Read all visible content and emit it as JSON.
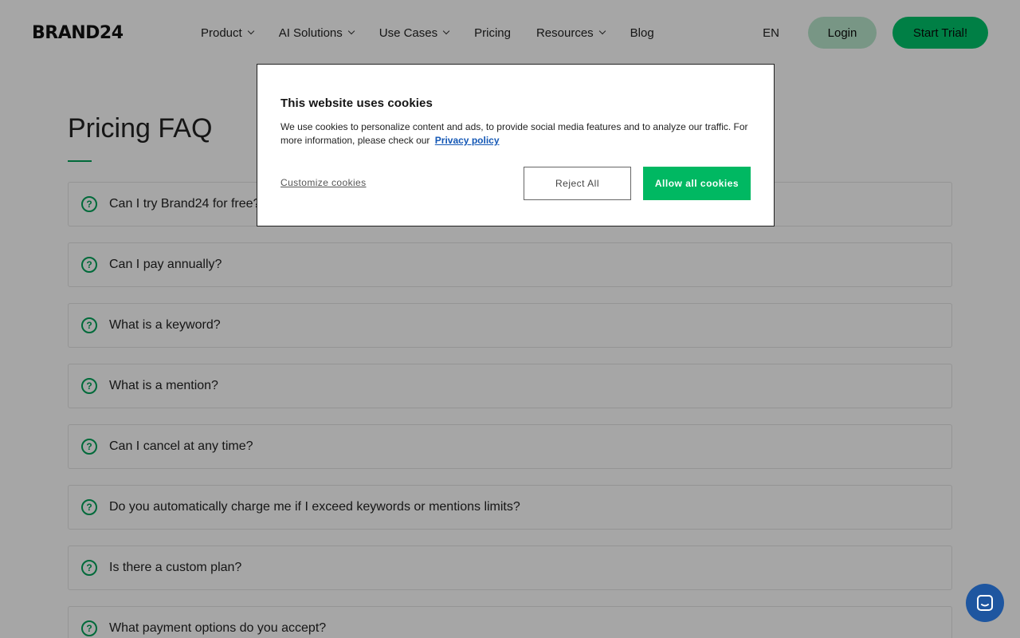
{
  "header": {
    "logo": "BRAND24",
    "nav": [
      {
        "label": "Product",
        "has_dropdown": true
      },
      {
        "label": "AI Solutions",
        "has_dropdown": true
      },
      {
        "label": "Use Cases",
        "has_dropdown": true
      },
      {
        "label": "Pricing",
        "has_dropdown": false
      },
      {
        "label": "Resources",
        "has_dropdown": true
      },
      {
        "label": "Blog",
        "has_dropdown": false
      }
    ],
    "language": "EN",
    "login_label": "Login",
    "trial_label": "Start Trial!"
  },
  "main": {
    "title": "Pricing FAQ",
    "faq": [
      {
        "question": "Can I try Brand24 for free?"
      },
      {
        "question": "Can I pay annually?"
      },
      {
        "question": "What is a keyword?"
      },
      {
        "question": "What is a mention?"
      },
      {
        "question": "Can I cancel at any time?"
      },
      {
        "question": "Do you automatically charge me if I exceed keywords or mentions limits?"
      },
      {
        "question": "Is there a custom plan?"
      },
      {
        "question": "What payment options do you accept?"
      }
    ]
  },
  "cookie_dialog": {
    "title": "This website uses cookies",
    "description": "We use cookies to personalize content and ads, to provide social media features and to analyze our traffic. For more information, please check our",
    "privacy_link": "Privacy policy",
    "customize_label": "Customize cookies",
    "reject_label": "Reject All",
    "allow_label": "Allow all cookies"
  },
  "colors": {
    "brand_green": "#00c46a",
    "icon_green": "#00a35a",
    "chat_blue": "#1e56a0",
    "link_blue": "#1357b5"
  }
}
